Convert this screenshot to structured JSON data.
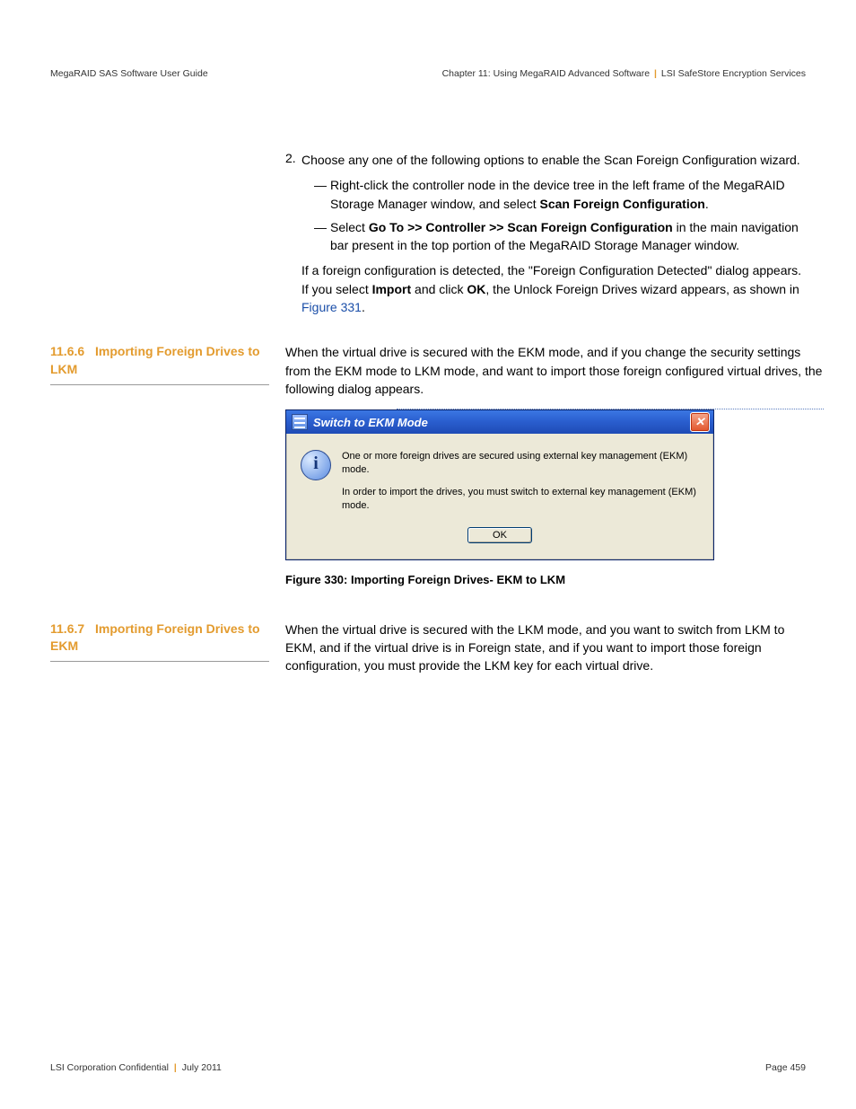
{
  "header": {
    "left": "MegaRAID SAS Software User Guide",
    "right_chapter": "Chapter 11: Using MegaRAID Advanced Software",
    "right_section": "LSI SafeStore Encryption Services"
  },
  "body": {
    "step2_num": "2.",
    "step2_intro": "Choose any one of the following options to enable the Scan Foreign Configuration wizard.",
    "bullet1_a": "Right-click the controller node in the device tree in the left frame of the MegaRAID Storage Manager window, and select ",
    "bullet1_b": "Scan Foreign Configuration",
    "bullet1_c": ".",
    "bullet2_a": "Select ",
    "bullet2_b": "Go To >> Controller >> Scan Foreign Configuration",
    "bullet2_c": " in the main navigation bar present in the top portion of the MegaRAID Storage Manager window.",
    "after_a": "If a foreign configuration is detected, the \"Foreign Configuration Detected\" dialog appears. If you select ",
    "after_b": "Import",
    "after_c": " and click ",
    "after_d": "OK",
    "after_e": ", the Unlock Foreign Drives wizard appears, as shown in ",
    "after_link": "Figure 331",
    "after_f": "."
  },
  "section_1166": {
    "num": "11.6.6",
    "title": "Importing Foreign Drives to LKM",
    "para": "When the virtual drive is secured with the EKM mode, and if you change the security settings from the EKM mode to LKM mode, and want to import those foreign configured virtual drives, the following dialog appears."
  },
  "dialog": {
    "title": "Switch to EKM Mode",
    "line1": "One or more foreign drives are secured using external key management (EKM) mode.",
    "line2": "In order to import the drives, you must switch to external key management (EKM) mode.",
    "ok": "OK",
    "close": "✕"
  },
  "figure_caption": "Figure 330:    Importing Foreign Drives- EKM to LKM",
  "section_1167": {
    "num": "11.6.7",
    "title": "Importing Foreign Drives to EKM",
    "para": "When the virtual drive is secured with the LKM mode, and you want to switch from LKM to EKM, and if the virtual drive is in Foreign state, and if you want to import those foreign configuration, you must provide the LKM key for each virtual drive."
  },
  "footer": {
    "left_a": "LSI Corporation Confidential",
    "left_b": "July 2011",
    "right": "Page 459"
  }
}
